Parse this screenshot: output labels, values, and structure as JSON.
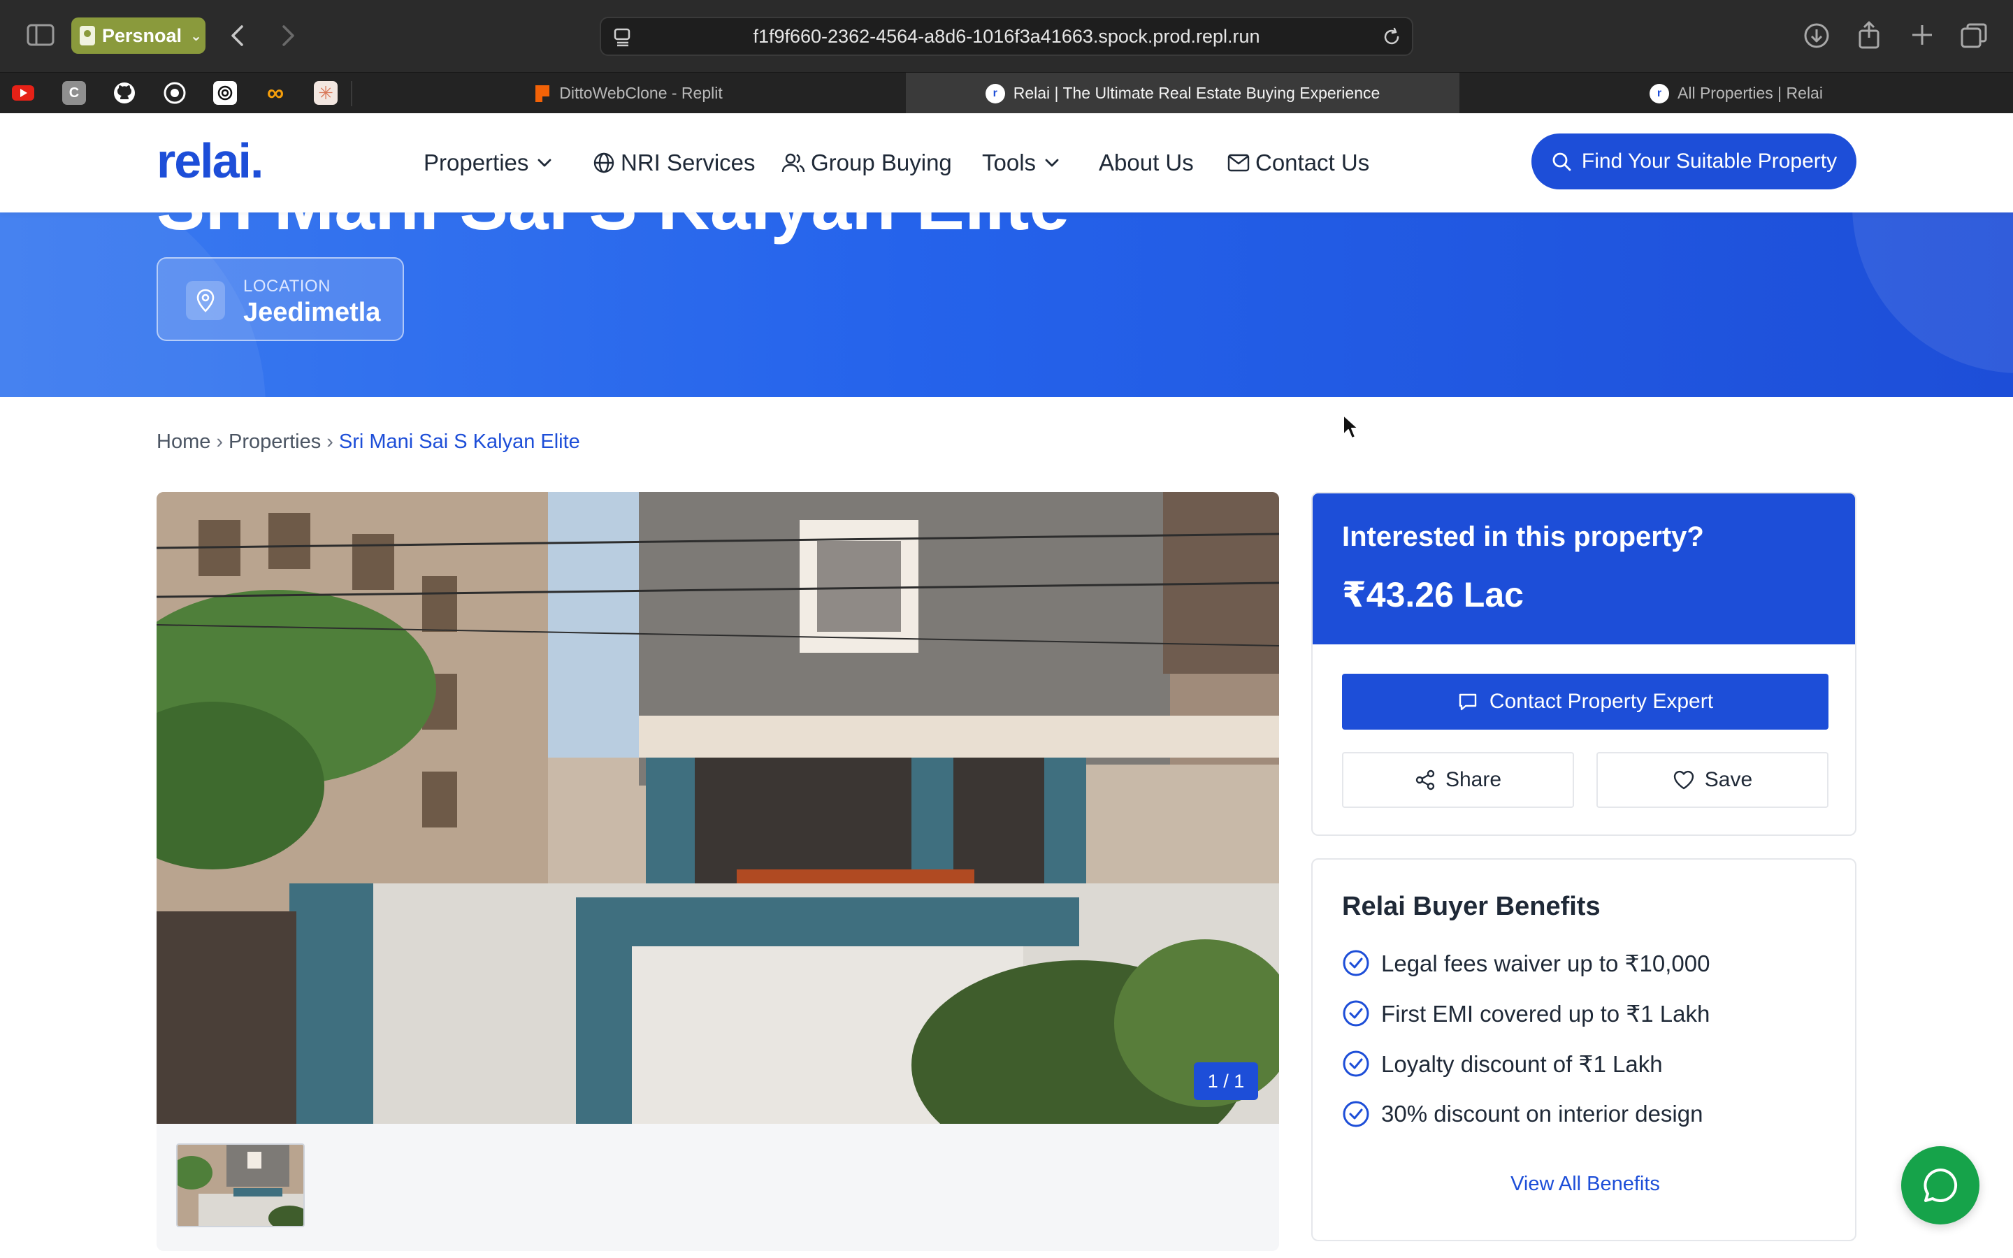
{
  "browser": {
    "profile_label": "Persnoal",
    "url": "f1f9f660-2362-4564-a8d6-1016f3a41663.spock.prod.repl.run",
    "tabs": [
      {
        "title": "DittoWebClone - Replit",
        "active": false
      },
      {
        "title": "Relai | The Ultimate Real Estate Buying Experience",
        "active": true
      },
      {
        "title": "All Properties | Relai",
        "active": false
      }
    ],
    "bookmark_icons": [
      "youtube-icon",
      "c-icon",
      "github-icon",
      "whatsapp-icon",
      "openai-icon",
      "infinity-icon",
      "claude-icon"
    ]
  },
  "nav": {
    "logo": "relai.",
    "items": {
      "properties": "Properties",
      "nri": "NRI Services",
      "group": "Group Buying",
      "tools": "Tools",
      "about": "About Us",
      "contact": "Contact Us"
    },
    "cta": "Find Your Suitable Property"
  },
  "hero": {
    "title": "Sri Mani Sai S Kalyan Elite",
    "location_label": "LOCATION",
    "location_value": "Jeedimetla"
  },
  "breadcrumb": {
    "home": "Home",
    "properties": "Properties",
    "current": "Sri Mani Sai S Kalyan Elite"
  },
  "gallery": {
    "counter": "1 / 1"
  },
  "interest": {
    "title": "Interested in this property?",
    "price": "₹43.26 Lac",
    "contact_label": "Contact Property Expert",
    "share_label": "Share",
    "save_label": "Save"
  },
  "benefits": {
    "title": "Relai Buyer Benefits",
    "items": [
      "Legal fees waiver up to ₹10,000",
      "First EMI covered up to ₹1 Lakh",
      "Loyalty discount of ₹1 Lakh",
      "30% discount on interior design"
    ],
    "view_all": "View All Benefits"
  },
  "colors": {
    "brand_blue": "#1d4ed8",
    "whatsapp_green": "#16a34a"
  }
}
